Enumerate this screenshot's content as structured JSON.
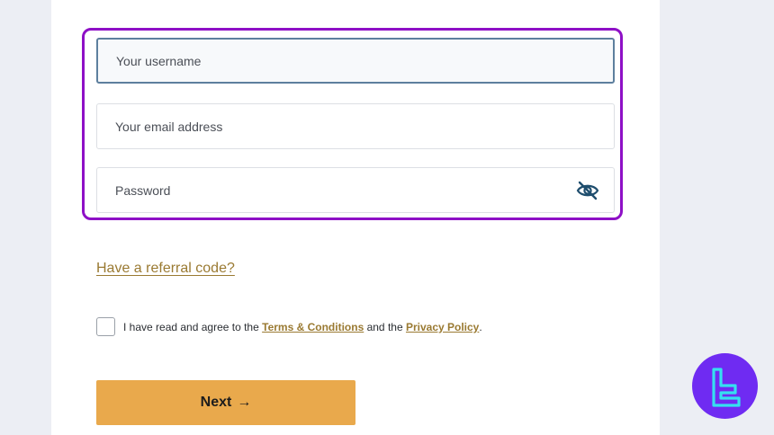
{
  "form": {
    "username_placeholder": "Your username",
    "email_placeholder": "Your email address",
    "password_placeholder": "Password",
    "referral_link": "Have a referral code?",
    "agreement": {
      "prefix": "I have read and agree to the ",
      "terms_link": "Terms & Conditions",
      "middle": " and the ",
      "privacy_link": "Privacy Policy",
      "suffix": "."
    },
    "next_label": "Next",
    "next_arrow": "→"
  },
  "icons": {
    "password_toggle": "eye-slash-icon",
    "next_arrow": "arrow-right-icon",
    "brand_logo": "brand-logo-icon"
  },
  "colors": {
    "highlight_border": "#8e10c6",
    "accent_gold": "#9a7a32",
    "button_bg": "#e9a94c",
    "logo_bg": "#6f2bf2",
    "logo_fg": "#35e0f0"
  }
}
